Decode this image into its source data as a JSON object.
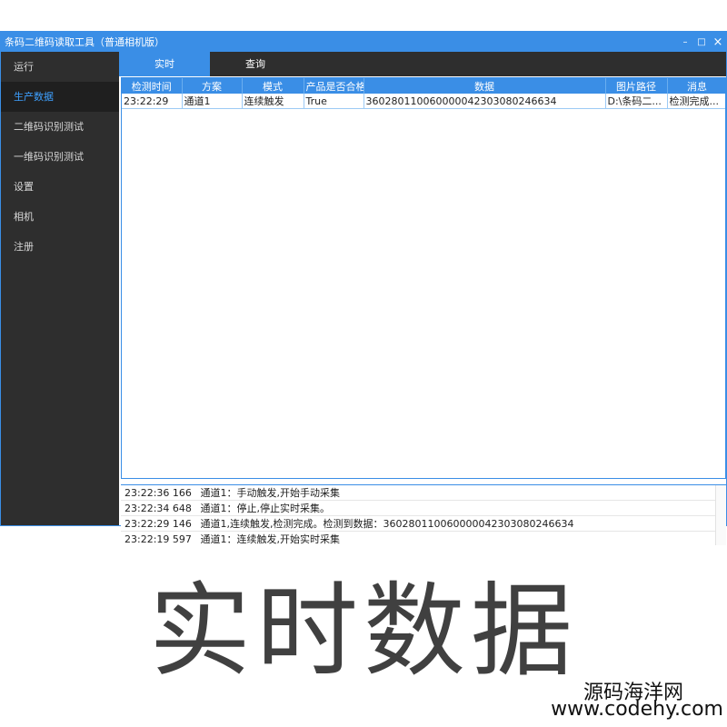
{
  "window": {
    "title": "条码二维码读取工具（普通相机版）"
  },
  "window_buttons": {
    "minimize": "–",
    "maximize": "□",
    "close": "×"
  },
  "sidebar": {
    "items": [
      {
        "label": "运行",
        "active": false
      },
      {
        "label": "生产数据",
        "active": true
      },
      {
        "label": "二维码识别测试",
        "active": false
      },
      {
        "label": "一维码识别测试",
        "active": false
      },
      {
        "label": "设置",
        "active": false
      },
      {
        "label": "相机",
        "active": false
      },
      {
        "label": "注册",
        "active": false
      }
    ]
  },
  "tabs": [
    {
      "label": "实时",
      "active": true
    },
    {
      "label": "查询",
      "active": false
    }
  ],
  "table": {
    "columns": [
      "检测时间",
      "方案",
      "模式",
      "产品是否合格",
      "数据",
      "图片路径",
      "消息"
    ],
    "rows": [
      [
        "23:22:29",
        "通道1",
        "连续触发",
        "True",
        "360280110060000042303080246634",
        "D:\\条码二...",
        "检测完成..."
      ]
    ]
  },
  "log": [
    {
      "time": "23:22:36 166",
      "msg": "通道1：手动触发,开始手动采集"
    },
    {
      "time": "23:22:34 648",
      "msg": "通道1：停止,停止实时采集。"
    },
    {
      "time": "23:22:29 146",
      "msg": "通道1,连续触发,检测完成。检测到数据：360280110060000042303080246634"
    },
    {
      "time": "23:22:19 597",
      "msg": "通道1：连续触发,开始实时采集"
    }
  ],
  "caption": "实时数据",
  "watermark": {
    "line1": "源码海洋网",
    "line2": "www.codehy.com"
  }
}
